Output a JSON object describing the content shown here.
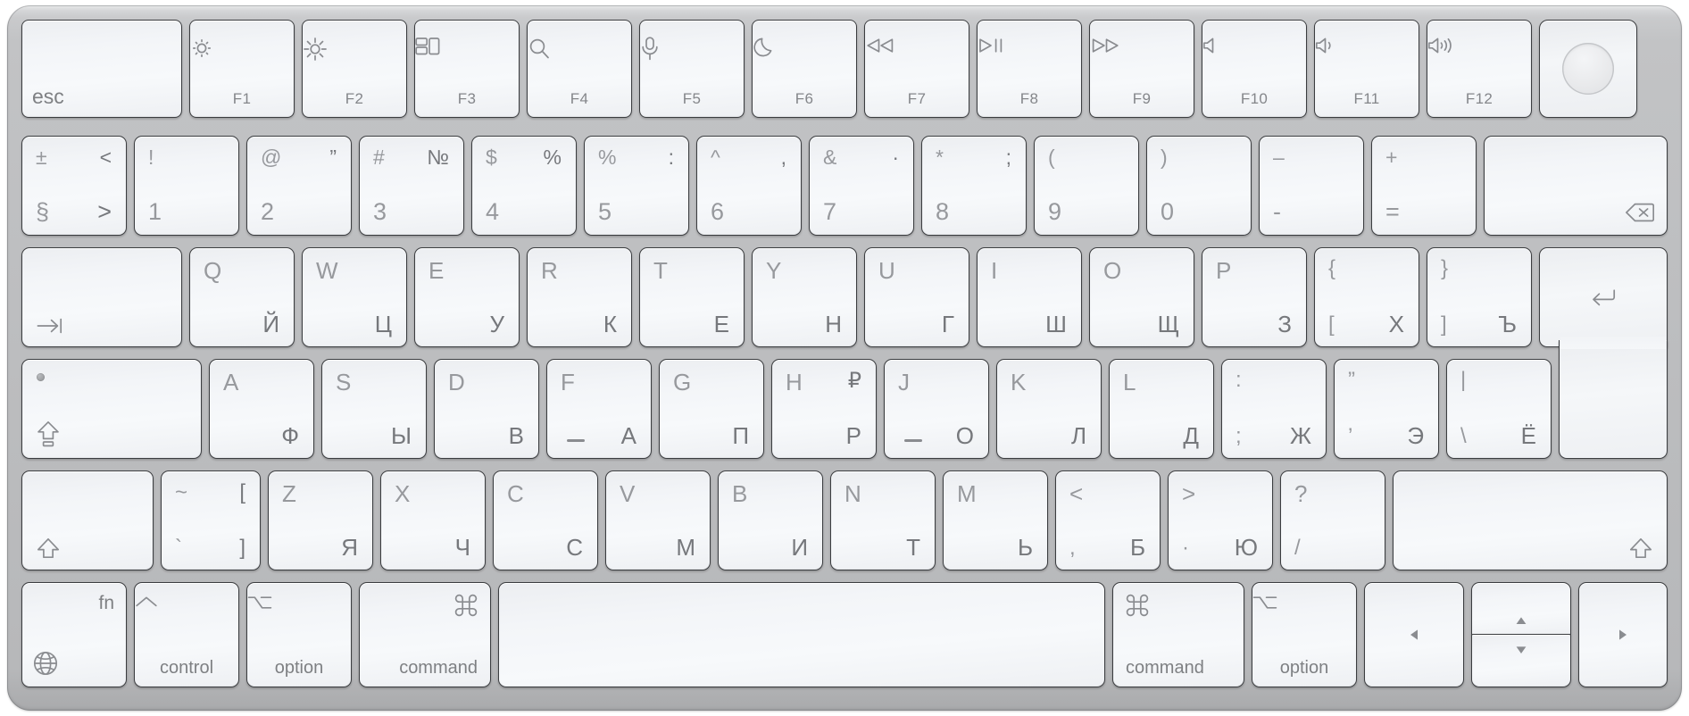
{
  "device": {
    "name": "Apple Magic Keyboard with Touch ID",
    "layout": "Russian (ISO)",
    "body_color": "#bcbdbf",
    "key_color": "#f4f6f8",
    "legend_color_primary": "#76787c",
    "legend_color_secondary": "#97999d"
  },
  "rows": {
    "function_row": [
      {
        "name": "esc",
        "label": "esc",
        "icon": ""
      },
      {
        "name": "f1",
        "label": "F1",
        "icon": "brightness-down-icon"
      },
      {
        "name": "f2",
        "label": "F2",
        "icon": "brightness-up-icon"
      },
      {
        "name": "f3",
        "label": "F3",
        "icon": "mission-control-icon"
      },
      {
        "name": "f4",
        "label": "F4",
        "icon": "spotlight-search-icon"
      },
      {
        "name": "f5",
        "label": "F5",
        "icon": "dictation-microphone-icon"
      },
      {
        "name": "f6",
        "label": "F6",
        "icon": "do-not-disturb-moon-icon"
      },
      {
        "name": "f7",
        "label": "F7",
        "icon": "rewind-icon"
      },
      {
        "name": "f8",
        "label": "F8",
        "icon": "play-pause-icon"
      },
      {
        "name": "f9",
        "label": "F9",
        "icon": "fast-forward-icon"
      },
      {
        "name": "f10",
        "label": "F10",
        "icon": "volume-mute-icon"
      },
      {
        "name": "f11",
        "label": "F11",
        "icon": "volume-down-icon"
      },
      {
        "name": "f12",
        "label": "F12",
        "icon": "volume-up-icon"
      },
      {
        "name": "touch-id",
        "label": "",
        "icon": "touch-id-sensor"
      }
    ],
    "number_row": [
      {
        "name": "section",
        "tl": "±",
        "bl": "§",
        "tr": "<",
        "br": ">"
      },
      {
        "name": "1",
        "tl": "!",
        "bl": "1",
        "tr": "",
        "br": ""
      },
      {
        "name": "2",
        "tl": "@",
        "bl": "2",
        "tr": "”",
        "br": ""
      },
      {
        "name": "3",
        "tl": "#",
        "bl": "3",
        "tr": "№",
        "br": ""
      },
      {
        "name": "4",
        "tl": "$",
        "bl": "4",
        "tr": "%",
        "br": ""
      },
      {
        "name": "5",
        "tl": "%",
        "bl": "5",
        "tr": ":",
        "br": ""
      },
      {
        "name": "6",
        "tl": "^",
        "bl": "6",
        "tr": ",",
        "br": ""
      },
      {
        "name": "7",
        "tl": "&",
        "bl": "7",
        "tr": "·",
        "br": ""
      },
      {
        "name": "8",
        "tl": "*",
        "bl": "8",
        "tr": ";",
        "br": ""
      },
      {
        "name": "9",
        "tl": "(",
        "bl": "9",
        "tr": "",
        "br": ""
      },
      {
        "name": "0",
        "tl": ")",
        "bl": "0",
        "tr": "",
        "br": ""
      },
      {
        "name": "minus",
        "tl": "–",
        "bl": "-",
        "tr": "",
        "br": ""
      },
      {
        "name": "equal",
        "tl": "+",
        "bl": "=",
        "tr": "",
        "br": ""
      },
      {
        "name": "delete",
        "tl": "",
        "bl": "",
        "tr": "",
        "br": "",
        "icon": "delete-backspace-icon"
      }
    ],
    "top_row": [
      {
        "name": "tab",
        "icon": "tab-icon",
        "latin": "",
        "cyr": ""
      },
      {
        "name": "q",
        "latin": "Q",
        "cyr": "Й"
      },
      {
        "name": "w",
        "latin": "W",
        "cyr": "Ц"
      },
      {
        "name": "e",
        "latin": "E",
        "cyr": "У"
      },
      {
        "name": "r",
        "latin": "R",
        "cyr": "К"
      },
      {
        "name": "t",
        "latin": "T",
        "cyr": "Е"
      },
      {
        "name": "y",
        "latin": "Y",
        "cyr": "Н"
      },
      {
        "name": "u",
        "latin": "U",
        "cyr": "Г"
      },
      {
        "name": "i",
        "latin": "I",
        "cyr": "Ш"
      },
      {
        "name": "o",
        "latin": "O",
        "cyr": "Щ"
      },
      {
        "name": "p",
        "latin": "P",
        "cyr": "З"
      },
      {
        "name": "bracketleft",
        "latin": "{",
        "sub": "[",
        "cyr": "Х"
      },
      {
        "name": "bracketright",
        "latin": "}",
        "sub": "]",
        "cyr": "Ъ"
      },
      {
        "name": "return",
        "icon": "return-icon",
        "latin": "",
        "cyr": ""
      }
    ],
    "home_row": [
      {
        "name": "capslock",
        "icon": "caps-lock-icon",
        "latin": "",
        "cyr": ""
      },
      {
        "name": "a",
        "latin": "A",
        "cyr": "Ф"
      },
      {
        "name": "s",
        "latin": "S",
        "cyr": "Ы"
      },
      {
        "name": "d",
        "latin": "D",
        "cyr": "В"
      },
      {
        "name": "f",
        "latin": "F",
        "cyr": "А",
        "bump": true
      },
      {
        "name": "g",
        "latin": "G",
        "cyr": "П"
      },
      {
        "name": "h",
        "latin": "H",
        "cyr": "Р",
        "extra": "₽"
      },
      {
        "name": "j",
        "latin": "J",
        "cyr": "О",
        "bump": true
      },
      {
        "name": "k",
        "latin": "K",
        "cyr": "Л"
      },
      {
        "name": "l",
        "latin": "L",
        "cyr": "Д"
      },
      {
        "name": "semicolon",
        "latin": ":",
        "sub": ";",
        "cyr": "Ж"
      },
      {
        "name": "quote",
        "latin": "”",
        "sub": "’",
        "cyr": "Э"
      },
      {
        "name": "backslash",
        "latin": "|",
        "sub": "\\",
        "cyr": "Ё"
      }
    ],
    "bottom_letter_row": [
      {
        "name": "shift-left",
        "icon": "shift-icon",
        "latin": "",
        "cyr": ""
      },
      {
        "name": "grave",
        "latin": "~",
        "sub": "`",
        "cyr": "",
        "alt_top": "[",
        "alt_bottom": "]"
      },
      {
        "name": "z",
        "latin": "Z",
        "cyr": "Я"
      },
      {
        "name": "x",
        "latin": "X",
        "cyr": "Ч"
      },
      {
        "name": "c",
        "latin": "C",
        "cyr": "С"
      },
      {
        "name": "v",
        "latin": "V",
        "cyr": "М"
      },
      {
        "name": "b",
        "latin": "B",
        "cyr": "И"
      },
      {
        "name": "n",
        "latin": "N",
        "cyr": "Т"
      },
      {
        "name": "m",
        "latin": "M",
        "cyr": "Ь"
      },
      {
        "name": "comma",
        "latin": "<",
        "sub": ",",
        "cyr": "Б"
      },
      {
        "name": "period",
        "latin": ">",
        "sub": "·",
        "cyr": "Ю"
      },
      {
        "name": "slash",
        "latin": "?",
        "sub": "/",
        "cyr": ""
      },
      {
        "name": "shift-right",
        "icon": "shift-icon",
        "latin": "",
        "cyr": ""
      }
    ],
    "modifier_row": [
      {
        "name": "fn",
        "top": "fn",
        "label": "",
        "icon": "globe-icon"
      },
      {
        "name": "control-left",
        "top": "^",
        "label": "control",
        "icon": "control-caret-icon"
      },
      {
        "name": "option-left",
        "top": "⌥",
        "label": "option",
        "icon": "option-icon"
      },
      {
        "name": "command-left",
        "top": "⌘",
        "label": "command",
        "icon": "command-icon"
      },
      {
        "name": "space",
        "top": "",
        "label": "",
        "icon": ""
      },
      {
        "name": "command-right",
        "top": "⌘",
        "label": "command",
        "icon": "command-icon"
      },
      {
        "name": "option-right",
        "top": "⌥",
        "label": "option",
        "icon": "option-icon"
      },
      {
        "name": "arrow-left",
        "top": "",
        "label": "",
        "icon": "arrow-left-icon"
      },
      {
        "name": "arrow-up",
        "top": "",
        "label": "",
        "icon": "arrow-up-icon"
      },
      {
        "name": "arrow-down",
        "top": "",
        "label": "",
        "icon": "arrow-down-icon"
      },
      {
        "name": "arrow-right",
        "top": "",
        "label": "",
        "icon": "arrow-right-icon"
      }
    ]
  }
}
